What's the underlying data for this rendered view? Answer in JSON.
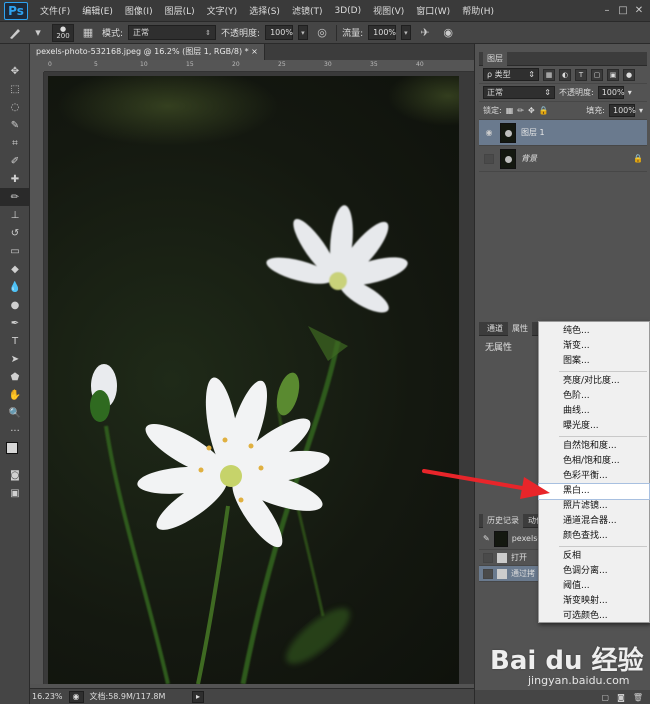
{
  "app": {
    "logo": "Ps"
  },
  "menubar": {
    "items": [
      "文件(F)",
      "编辑(E)",
      "图像(I)",
      "图层(L)",
      "文字(Y)",
      "选择(S)",
      "滤镜(T)",
      "3D(D)",
      "视图(V)",
      "窗口(W)",
      "帮助(H)"
    ]
  },
  "options": {
    "brush_size": "200",
    "mode_label": "模式:",
    "mode_value": "正常",
    "opacity_label": "不透明度:",
    "opacity_value": "100%",
    "flow_label": "流量:",
    "flow_value": "100%"
  },
  "document": {
    "tab_title": "pexels-photo-532168.jpeg @ 16.2% (图层 1, RGB/8) * ×",
    "ruler_marks": [
      "0",
      "5",
      "10",
      "15",
      "20",
      "25",
      "30",
      "35",
      "40"
    ],
    "zoom": "16.23%",
    "doc_size": "文档:58.9M/117.8M"
  },
  "layers_panel": {
    "title": "图层",
    "filter_label": "ρ 类型",
    "blend_mode": "正常",
    "opacity_label": "不透明度:",
    "opacity_value": "100%",
    "lock_label": "锁定:",
    "fill_label": "填充:",
    "fill_value": "100%",
    "layers": [
      {
        "name": "图层 1",
        "selected": true
      },
      {
        "name": "背景",
        "selected": false
      }
    ]
  },
  "properties_panel": {
    "tabs": [
      "通道",
      "属性"
    ],
    "body": "无属性"
  },
  "history_panel": {
    "tabs": [
      "历史记录",
      "动作"
    ],
    "snapshot": "pexels-",
    "items": [
      "打开",
      "通过拷"
    ]
  },
  "adjustment_menu": {
    "groups": [
      [
        "纯色...",
        "渐变...",
        "图案..."
      ],
      [
        "亮度/对比度...",
        "色阶...",
        "曲线...",
        "曝光度..."
      ],
      [
        "自然饱和度...",
        "色相/饱和度...",
        "色彩平衡...",
        "黑白...",
        "照片滤镜...",
        "通道混合器...",
        "颜色查找..."
      ],
      [
        "反相",
        "色调分离...",
        "阈值...",
        "渐变映射...",
        "可选颜色..."
      ]
    ],
    "hovered": "黑白..."
  },
  "watermark": {
    "brand": "Bai du 经验",
    "url": "jingyan.baidu.com"
  },
  "colors": {
    "arrow": "#e8252a",
    "selection": "#6a7a8e"
  }
}
